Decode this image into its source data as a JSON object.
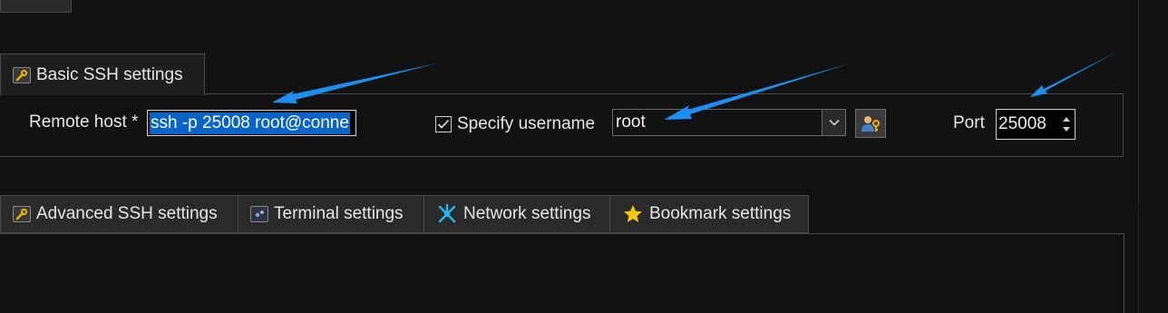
{
  "tabs": {
    "basic": {
      "label": "Basic SSH settings",
      "icon": "wrench-icon"
    },
    "advanced": {
      "label": "Advanced SSH settings",
      "icon": "wrench-icon"
    },
    "terminal": {
      "label": "Terminal settings",
      "icon": "terminal-icon"
    },
    "network": {
      "label": "Network settings",
      "icon": "network-icon"
    },
    "bookmark": {
      "label": "Bookmark settings",
      "icon": "star-icon"
    }
  },
  "basic": {
    "remote_host_label": "Remote host *",
    "remote_host_value": "ssh -p 25008 root@conne",
    "specify_username_label": "Specify username",
    "specify_username_checked": true,
    "username_value": "root",
    "port_label": "Port",
    "port_value": "25008"
  },
  "colors": {
    "background": "#121212",
    "selection": "#0a64c8",
    "annotation_arrow": "#1e8ff0",
    "star": "#f5c518",
    "network_icon": "#29b6f6"
  }
}
